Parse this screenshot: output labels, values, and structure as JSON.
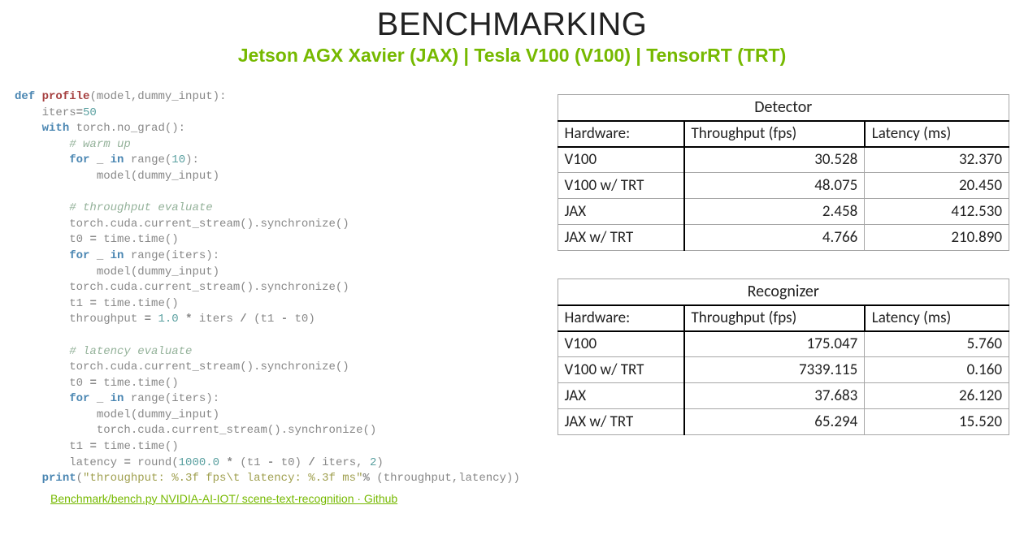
{
  "title": "BENCHMARKING",
  "subtitle": "Jetson AGX Xavier (JAX) | Tesla V100 (V100) | TensorRT (TRT)",
  "github_link": "Benchmark/bench.py NVIDIA-AI-IOT/ scene-text-recognition · Github",
  "code": {
    "l1a": "def",
    "l1b": "profile",
    "l1c": "(model,dummy_input):",
    "l2a": "iters",
    "l2b": "=",
    "l2c": "50",
    "l3a": "with",
    "l3b": "torch.no_grad():",
    "l4": "# warm up",
    "l5a": "for",
    "l5b": "_",
    "l5c": "in",
    "l5d": "range(",
    "l5e": "10",
    "l5f": "):",
    "l6": "model(dummy_input)",
    "l8": "# throughput evaluate",
    "l9": "torch.cuda.current_stream().synchronize()",
    "l10a": "t0 ",
    "l10b": "=",
    "l10c": " time.time()",
    "l11a": "for",
    "l11b": "_",
    "l11c": "in",
    "l11d": "range(iters):",
    "l12": "model(dummy_input)",
    "l13": "torch.cuda.current_stream().synchronize()",
    "l14a": "t1 ",
    "l14b": "=",
    "l14c": " time.time()",
    "l15a": "throughput ",
    "l15b": "=",
    "l15c": " ",
    "l15d": "1.0",
    "l15e": " ",
    "l15f": "*",
    "l15g": " iters ",
    "l15h": "/",
    "l15i": " (t1 ",
    "l15j": "-",
    "l15k": " t0)",
    "l17": "# latency evaluate",
    "l18": "torch.cuda.current_stream().synchronize()",
    "l19a": "t0 ",
    "l19b": "=",
    "l19c": " time.time()",
    "l20a": "for",
    "l20b": "_",
    "l20c": "in",
    "l20d": "range(iters):",
    "l21": "model(dummy_input)",
    "l22": "torch.cuda.current_stream().synchronize()",
    "l23a": "t1 ",
    "l23b": "=",
    "l23c": " time.time()",
    "l24a": "latency ",
    "l24b": "=",
    "l24c": " round(",
    "l24d": "1000.0",
    "l24e": " ",
    "l24f": "*",
    "l24g": " (t1 ",
    "l24h": "-",
    "l24i": " t0) ",
    "l24j": "/",
    "l24k": " iters, ",
    "l24l": "2",
    "l24m": ")",
    "l25a": "print",
    "l25b": "(",
    "l25c": "\"throughput: %.3f fps\\t latency: %.3f ms\"",
    "l25d": "%",
    "l25e": " (throughput,latency))"
  },
  "tables": {
    "detector": {
      "caption": "Detector",
      "headers": [
        "Hardware:",
        "Throughput (fps)",
        "Latency (ms)"
      ],
      "rows": [
        [
          "V100",
          "30.528",
          "32.370"
        ],
        [
          "V100 w/ TRT",
          "48.075",
          "20.450"
        ],
        [
          "JAX",
          "2.458",
          "412.530"
        ],
        [
          "JAX w/ TRT",
          "4.766",
          "210.890"
        ]
      ]
    },
    "recognizer": {
      "caption": "Recognizer",
      "headers": [
        "Hardware:",
        "Throughput (fps)",
        "Latency (ms)"
      ],
      "rows": [
        [
          "V100",
          "175.047",
          "5.760"
        ],
        [
          "V100 w/ TRT",
          "7339.115",
          "0.160"
        ],
        [
          "JAX",
          "37.683",
          "26.120"
        ],
        [
          "JAX w/ TRT",
          "65.294",
          "15.520"
        ]
      ]
    }
  },
  "chart_data": [
    {
      "type": "table",
      "title": "Detector",
      "columns": [
        "Hardware",
        "Throughput (fps)",
        "Latency (ms)"
      ],
      "rows": [
        {
          "Hardware": "V100",
          "Throughput (fps)": 30.528,
          "Latency (ms)": 32.37
        },
        {
          "Hardware": "V100 w/ TRT",
          "Throughput (fps)": 48.075,
          "Latency (ms)": 20.45
        },
        {
          "Hardware": "JAX",
          "Throughput (fps)": 2.458,
          "Latency (ms)": 412.53
        },
        {
          "Hardware": "JAX w/ TRT",
          "Throughput (fps)": 4.766,
          "Latency (ms)": 210.89
        }
      ]
    },
    {
      "type": "table",
      "title": "Recognizer",
      "columns": [
        "Hardware",
        "Throughput (fps)",
        "Latency (ms)"
      ],
      "rows": [
        {
          "Hardware": "V100",
          "Throughput (fps)": 175.047,
          "Latency (ms)": 5.76
        },
        {
          "Hardware": "V100 w/ TRT",
          "Throughput (fps)": 7339.115,
          "Latency (ms)": 0.16
        },
        {
          "Hardware": "JAX",
          "Throughput (fps)": 37.683,
          "Latency (ms)": 26.12
        },
        {
          "Hardware": "JAX w/ TRT",
          "Throughput (fps)": 65.294,
          "Latency (ms)": 15.52
        }
      ]
    }
  ]
}
